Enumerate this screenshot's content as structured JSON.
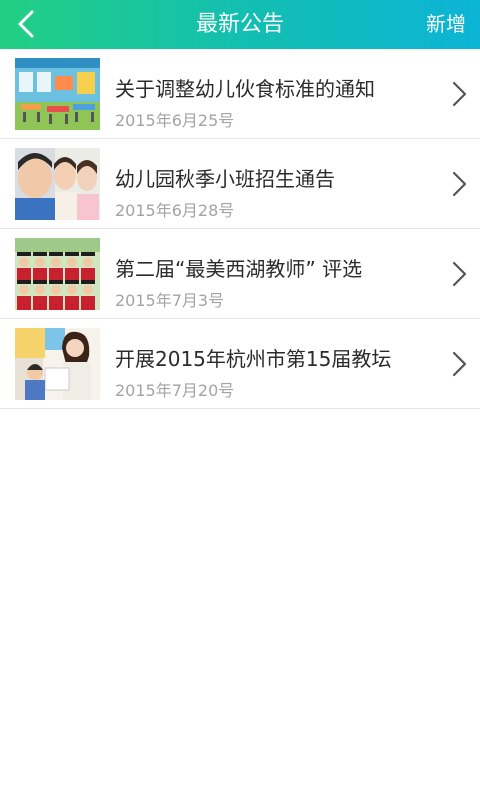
{
  "header": {
    "title": "最新公告",
    "add_label": "新增",
    "back_icon": "chevron-left-icon",
    "gradient_colors": [
      "#22cf83",
      "#13bfb0",
      "#0cb4d6"
    ]
  },
  "announcements": [
    {
      "title": "关于调整幼儿伙食标准的通知",
      "date": "2015年6月25号",
      "image": "classroom-photo"
    },
    {
      "title": "幼儿园秋季小班招生通告",
      "date": "2015年6月28号",
      "image": "children-faces-photo"
    },
    {
      "title": "第二届“最美西湖教师” 评选",
      "date": "2015年7月3号",
      "image": "graduation-group-photo"
    },
    {
      "title": "开展2015年杭州市第15届教坛",
      "date": "2015年7月20号",
      "image": "teacher-and-child-photo"
    }
  ],
  "row_icon": "chevron-right-icon"
}
